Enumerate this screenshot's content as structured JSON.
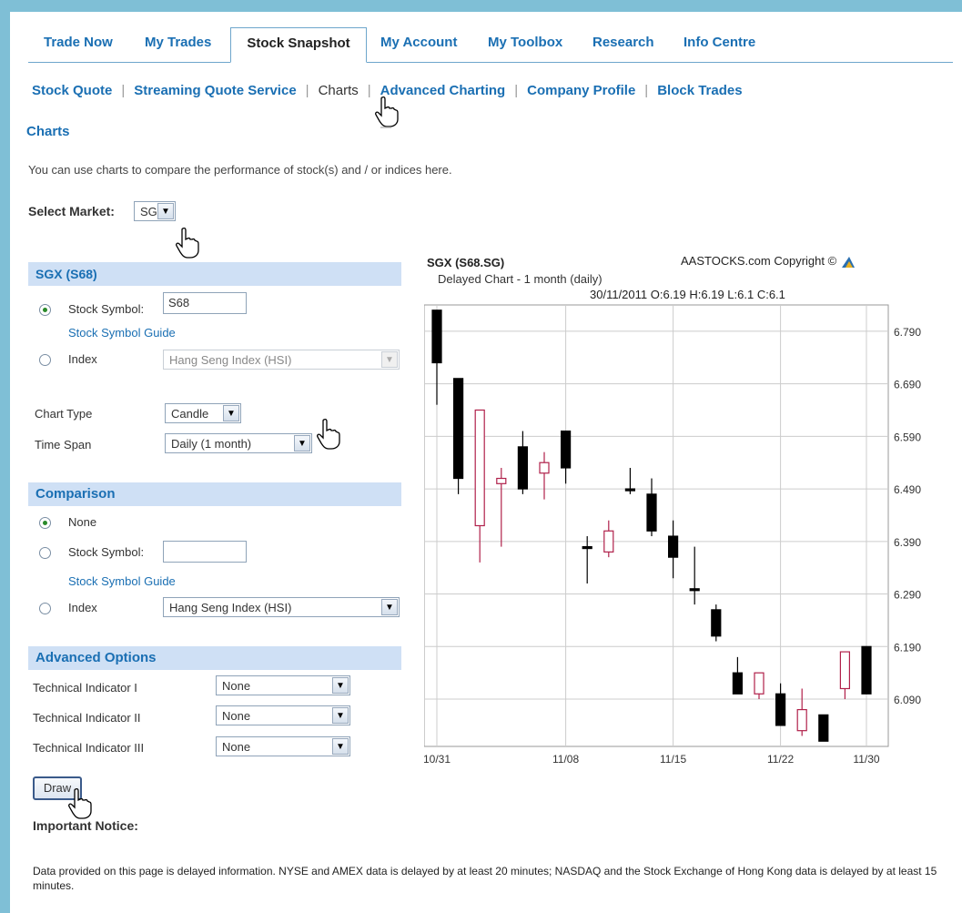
{
  "tabs": [
    "Trade Now",
    "My Trades",
    "Stock Snapshot",
    "My Account",
    "My Toolbox",
    "Research",
    "Info Centre"
  ],
  "active_tab": "Stock Snapshot",
  "subnav": [
    "Stock Quote",
    "Streaming Quote Service",
    "Charts",
    "Advanced Charting",
    "Company Profile",
    "Block Trades"
  ],
  "subnav_current": "Charts",
  "page_title": "Charts",
  "intro": "You can use charts to compare the performance of stock(s) and / or indices here.",
  "market": {
    "label": "Select Market:",
    "value": "SG"
  },
  "stock_section": {
    "title": "SGX (S68)",
    "stock_symbol_label": "Stock Symbol:",
    "stock_symbol_value": "S68",
    "guide_link": "Stock Symbol Guide",
    "index_label": "Index",
    "index_value": "Hang Seng Index (HSI)"
  },
  "chart_type": {
    "label": "Chart Type",
    "value": "Candle"
  },
  "time_span": {
    "label": "Time Span",
    "value": "Daily (1 month)"
  },
  "comparison": {
    "title": "Comparison",
    "none_label": "None",
    "stock_symbol_label": "Stock Symbol:",
    "stock_symbol_value": "",
    "guide_link": "Stock Symbol Guide",
    "index_label": "Index",
    "index_value": "Hang Seng Index (HSI)"
  },
  "advanced": {
    "title": "Advanced Options",
    "indicators": [
      {
        "label": "Technical Indicator I",
        "value": "None"
      },
      {
        "label": "Technical Indicator II",
        "value": "None"
      },
      {
        "label": "Technical Indicator III",
        "value": "None"
      }
    ]
  },
  "draw_button": "Draw",
  "notice_title": "Important Notice:",
  "notice_text": "Data provided on this page is delayed information. NYSE and AMEX data is delayed by at least 20 minutes; NASDAQ and the Stock Exchange of Hong Kong data is delayed by at least 15 minutes.",
  "chart_header": {
    "title": "SGX (S68.SG)",
    "subtitle": "Delayed Chart - 1 month (daily)",
    "copyright": "AASTOCKS.com Copyright ©",
    "ohlc": "30/11/2011    O:6.19  H:6.19  L:6.1  C:6.1"
  },
  "colors": {
    "tab_link": "#1a6fb3",
    "section_bg": "#cfe0f5",
    "frame": "#7fbfd6",
    "up_candle": "#b0204a",
    "down_candle": "#000000"
  },
  "chart_data": {
    "type": "candlestick",
    "x_tick_labels": [
      "10/31",
      "11/08",
      "11/15",
      "11/22",
      "11/30"
    ],
    "y_tick_labels": [
      "6.790",
      "6.690",
      "6.590",
      "6.490",
      "6.390",
      "6.290",
      "6.190",
      "6.090"
    ],
    "ylim": [
      6.0,
      6.84
    ],
    "candles": [
      {
        "date": "10/31",
        "open": 6.83,
        "high": 6.83,
        "low": 6.65,
        "close": 6.73
      },
      {
        "date": "11/01",
        "open": 6.7,
        "high": 6.7,
        "low": 6.48,
        "close": 6.51
      },
      {
        "date": "11/02",
        "open": 6.42,
        "high": 6.64,
        "low": 6.35,
        "close": 6.64
      },
      {
        "date": "11/03",
        "open": 6.5,
        "high": 6.53,
        "low": 6.38,
        "close": 6.51
      },
      {
        "date": "11/04",
        "open": 6.57,
        "high": 6.6,
        "low": 6.48,
        "close": 6.49
      },
      {
        "date": "11/07",
        "open": 6.52,
        "high": 6.56,
        "low": 6.47,
        "close": 6.54
      },
      {
        "date": "11/08",
        "open": 6.6,
        "high": 6.6,
        "low": 6.5,
        "close": 6.53
      },
      {
        "date": "11/09",
        "open": 6.38,
        "high": 6.4,
        "low": 6.31,
        "close": 6.38
      },
      {
        "date": "11/10",
        "open": 6.37,
        "high": 6.43,
        "low": 6.36,
        "close": 6.41
      },
      {
        "date": "11/11",
        "open": 6.49,
        "high": 6.53,
        "low": 6.48,
        "close": 6.49
      },
      {
        "date": "11/14",
        "open": 6.48,
        "high": 6.51,
        "low": 6.4,
        "close": 6.41
      },
      {
        "date": "11/15",
        "open": 6.4,
        "high": 6.43,
        "low": 6.32,
        "close": 6.36
      },
      {
        "date": "11/16",
        "open": 6.3,
        "high": 6.38,
        "low": 6.27,
        "close": 6.3
      },
      {
        "date": "11/17",
        "open": 6.26,
        "high": 6.27,
        "low": 6.2,
        "close": 6.21
      },
      {
        "date": "11/18",
        "open": 6.14,
        "high": 6.17,
        "low": 6.1,
        "close": 6.1
      },
      {
        "date": "11/21",
        "open": 6.1,
        "high": 6.14,
        "low": 6.09,
        "close": 6.14
      },
      {
        "date": "11/22",
        "open": 6.1,
        "high": 6.12,
        "low": 6.04,
        "close": 6.04
      },
      {
        "date": "11/23",
        "open": 6.03,
        "high": 6.11,
        "low": 6.02,
        "close": 6.07
      },
      {
        "date": "11/24",
        "open": 6.06,
        "high": 6.06,
        "low": 6.01,
        "close": 6.01
      },
      {
        "date": "11/28",
        "open": 6.11,
        "high": 6.18,
        "low": 6.09,
        "close": 6.18
      },
      {
        "date": "11/30",
        "open": 6.19,
        "high": 6.19,
        "low": 6.1,
        "close": 6.1
      }
    ]
  }
}
